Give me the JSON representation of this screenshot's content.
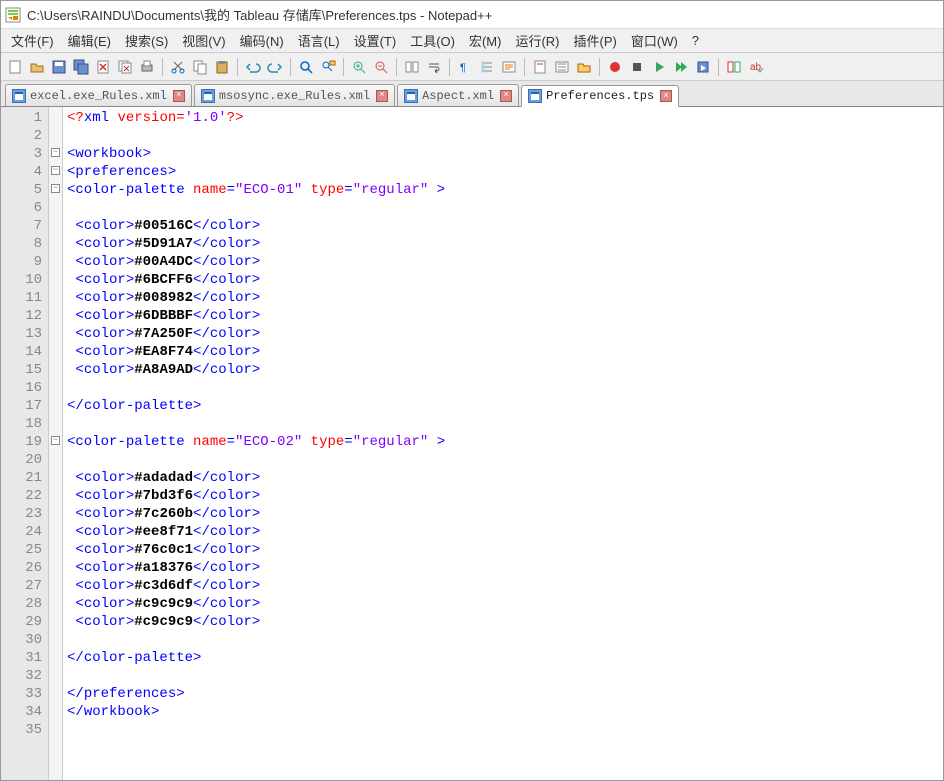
{
  "title": "C:\\Users\\RAINDU\\Documents\\我的 Tableau 存储库\\Preferences.tps - Notepad++",
  "menu": {
    "file": "文件(F)",
    "edit": "编辑(E)",
    "search": "搜索(S)",
    "view": "视图(V)",
    "encoding": "编码(N)",
    "language": "语言(L)",
    "settings": "设置(T)",
    "tools": "工具(O)",
    "macro": "宏(M)",
    "run": "运行(R)",
    "plugins": "插件(P)",
    "window": "窗口(W)",
    "help": "?"
  },
  "tabs": [
    {
      "label": "excel.exe_Rules.xml",
      "active": false
    },
    {
      "label": "msosync.exe_Rules.xml",
      "active": false
    },
    {
      "label": "Aspect.xml",
      "active": false
    },
    {
      "label": "Preferences.tps",
      "active": true
    }
  ],
  "lines": [
    {
      "n": 1,
      "fold": "",
      "html": "<span class='pi'>&lt;?</span><span class='pik'>xml</span> <span class='pi'>version=</span><span class='piv'>'1.0'</span><span class='pi'>?&gt;</span>"
    },
    {
      "n": 2,
      "fold": "",
      "html": ""
    },
    {
      "n": 3,
      "fold": "minus",
      "html": "<span class='br'>&lt;</span><span class='tag'>workbook</span><span class='br'>&gt;</span>"
    },
    {
      "n": 4,
      "fold": "minus",
      "html": "<span class='br'>&lt;</span><span class='tag'>preferences</span><span class='br'>&gt;</span>"
    },
    {
      "n": 5,
      "fold": "minus",
      "html": "<span class='br'>&lt;</span><span class='tag'>color-palette</span> <span class='attr'>name</span><span class='br'>=</span><span class='val'>\"ECO-01\"</span> <span class='attr'>type</span><span class='br'>=</span><span class='val'>\"regular\"</span> <span class='br'>&gt;</span>"
    },
    {
      "n": 6,
      "fold": "",
      "html": ""
    },
    {
      "n": 7,
      "fold": "",
      "html": " <span class='br'>&lt;</span><span class='tag'>color</span><span class='br'>&gt;</span><span class='txt'>#00516C</span><span class='br'>&lt;/</span><span class='tag'>color</span><span class='br'>&gt;</span>"
    },
    {
      "n": 8,
      "fold": "",
      "html": " <span class='br'>&lt;</span><span class='tag'>color</span><span class='br'>&gt;</span><span class='txt'>#5D91A7</span><span class='br'>&lt;/</span><span class='tag'>color</span><span class='br'>&gt;</span>"
    },
    {
      "n": 9,
      "fold": "",
      "html": " <span class='br'>&lt;</span><span class='tag'>color</span><span class='br'>&gt;</span><span class='txt'>#00A4DC</span><span class='br'>&lt;/</span><span class='tag'>color</span><span class='br'>&gt;</span>"
    },
    {
      "n": 10,
      "fold": "",
      "html": " <span class='br'>&lt;</span><span class='tag'>color</span><span class='br'>&gt;</span><span class='txt'>#6BCFF6</span><span class='br'>&lt;/</span><span class='tag'>color</span><span class='br'>&gt;</span>"
    },
    {
      "n": 11,
      "fold": "",
      "html": " <span class='br'>&lt;</span><span class='tag'>color</span><span class='br'>&gt;</span><span class='txt'>#008982</span><span class='br'>&lt;/</span><span class='tag'>color</span><span class='br'>&gt;</span>"
    },
    {
      "n": 12,
      "fold": "",
      "html": " <span class='br'>&lt;</span><span class='tag'>color</span><span class='br'>&gt;</span><span class='txt'>#6DBBBF</span><span class='br'>&lt;/</span><span class='tag'>color</span><span class='br'>&gt;</span>"
    },
    {
      "n": 13,
      "fold": "",
      "html": " <span class='br'>&lt;</span><span class='tag'>color</span><span class='br'>&gt;</span><span class='txt'>#7A250F</span><span class='br'>&lt;/</span><span class='tag'>color</span><span class='br'>&gt;</span>"
    },
    {
      "n": 14,
      "fold": "",
      "html": " <span class='br'>&lt;</span><span class='tag'>color</span><span class='br'>&gt;</span><span class='txt'>#EA8F74</span><span class='br'>&lt;/</span><span class='tag'>color</span><span class='br'>&gt;</span>"
    },
    {
      "n": 15,
      "fold": "",
      "html": " <span class='br'>&lt;</span><span class='tag'>color</span><span class='br'>&gt;</span><span class='txt'>#A8A9AD</span><span class='br'>&lt;/</span><span class='tag'>color</span><span class='br'>&gt;</span>"
    },
    {
      "n": 16,
      "fold": "",
      "html": ""
    },
    {
      "n": 17,
      "fold": "",
      "html": "<span class='br'>&lt;/</span><span class='tag'>color-palette</span><span class='br'>&gt;</span>"
    },
    {
      "n": 18,
      "fold": "",
      "html": ""
    },
    {
      "n": 19,
      "fold": "minus",
      "html": "<span class='br'>&lt;</span><span class='tag'>color-palette</span> <span class='attr'>name</span><span class='br'>=</span><span class='val'>\"ECO-02\"</span> <span class='attr'>type</span><span class='br'>=</span><span class='val'>\"regular\"</span> <span class='br'>&gt;</span>"
    },
    {
      "n": 20,
      "fold": "",
      "html": ""
    },
    {
      "n": 21,
      "fold": "",
      "html": " <span class='br'>&lt;</span><span class='tag'>color</span><span class='br'>&gt;</span><span class='txt'>#adadad</span><span class='br'>&lt;/</span><span class='tag'>color</span><span class='br'>&gt;</span>"
    },
    {
      "n": 22,
      "fold": "",
      "html": " <span class='br'>&lt;</span><span class='tag'>color</span><span class='br'>&gt;</span><span class='txt'>#7bd3f6</span><span class='br'>&lt;/</span><span class='tag'>color</span><span class='br'>&gt;</span>"
    },
    {
      "n": 23,
      "fold": "",
      "html": " <span class='br'>&lt;</span><span class='tag'>color</span><span class='br'>&gt;</span><span class='txt'>#7c260b</span><span class='br'>&lt;/</span><span class='tag'>color</span><span class='br'>&gt;</span>"
    },
    {
      "n": 24,
      "fold": "",
      "html": " <span class='br'>&lt;</span><span class='tag'>color</span><span class='br'>&gt;</span><span class='txt'>#ee8f71</span><span class='br'>&lt;/</span><span class='tag'>color</span><span class='br'>&gt;</span>"
    },
    {
      "n": 25,
      "fold": "",
      "html": " <span class='br'>&lt;</span><span class='tag'>color</span><span class='br'>&gt;</span><span class='txt'>#76c0c1</span><span class='br'>&lt;/</span><span class='tag'>color</span><span class='br'>&gt;</span>"
    },
    {
      "n": 26,
      "fold": "",
      "html": " <span class='br'>&lt;</span><span class='tag'>color</span><span class='br'>&gt;</span><span class='txt'>#a18376</span><span class='br'>&lt;/</span><span class='tag'>color</span><span class='br'>&gt;</span>"
    },
    {
      "n": 27,
      "fold": "",
      "html": " <span class='br'>&lt;</span><span class='tag'>color</span><span class='br'>&gt;</span><span class='txt'>#c3d6df</span><span class='br'>&lt;/</span><span class='tag'>color</span><span class='br'>&gt;</span>"
    },
    {
      "n": 28,
      "fold": "",
      "html": " <span class='br'>&lt;</span><span class='tag'>color</span><span class='br'>&gt;</span><span class='txt'>#c9c9c9</span><span class='br'>&lt;/</span><span class='tag'>color</span><span class='br'>&gt;</span>"
    },
    {
      "n": 29,
      "fold": "",
      "html": " <span class='br'>&lt;</span><span class='tag'>color</span><span class='br'>&gt;</span><span class='txt'>#c9c9c9</span><span class='br'>&lt;/</span><span class='tag'>color</span><span class='br'>&gt;</span>"
    },
    {
      "n": 30,
      "fold": "",
      "html": ""
    },
    {
      "n": 31,
      "fold": "",
      "html": "<span class='br'>&lt;/</span><span class='tag'>color-palette</span><span class='br'>&gt;</span>"
    },
    {
      "n": 32,
      "fold": "",
      "html": ""
    },
    {
      "n": 33,
      "fold": "",
      "html": "<span class='br'>&lt;/</span><span class='tag'>preferences</span><span class='br'>&gt;</span>"
    },
    {
      "n": 34,
      "fold": "",
      "html": "<span class='br'>&lt;/</span><span class='tag'>workbook</span><span class='br'>&gt;</span>"
    },
    {
      "n": 35,
      "fold": "",
      "html": ""
    }
  ]
}
